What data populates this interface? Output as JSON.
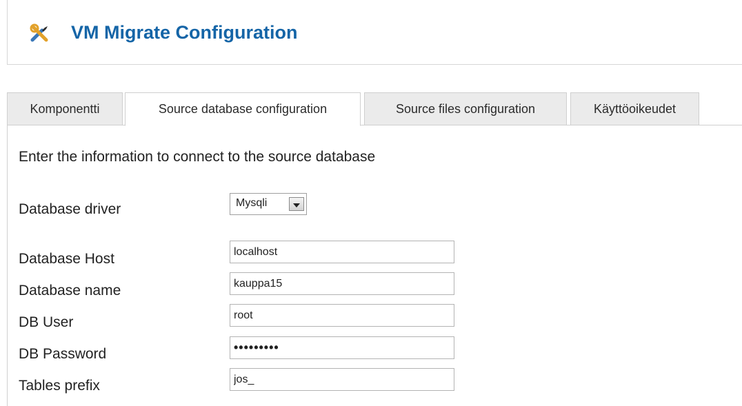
{
  "header": {
    "title": "VM Migrate Configuration",
    "icon": "tools-icon"
  },
  "tabs": [
    {
      "label": "Komponentti",
      "active": false
    },
    {
      "label": "Source database configuration",
      "active": true
    },
    {
      "label": "Source files configuration",
      "active": false
    },
    {
      "label": "Käyttöoikeudet",
      "active": false
    }
  ],
  "form": {
    "intro": "Enter the information to connect to the source database",
    "driver": {
      "label": "Database driver",
      "value": "Mysqli"
    },
    "host": {
      "label": "Database Host",
      "value": "localhost"
    },
    "name": {
      "label": "Database name",
      "value": "kauppa15"
    },
    "user": {
      "label": "DB User",
      "value": "root"
    },
    "password": {
      "label": "DB Password",
      "value": "•••••••••"
    },
    "prefix": {
      "label": "Tables prefix",
      "value": "jos_"
    }
  },
  "colors": {
    "title": "#1565a7",
    "tab_bg": "#ebebeb",
    "border": "#cfcfcf"
  }
}
